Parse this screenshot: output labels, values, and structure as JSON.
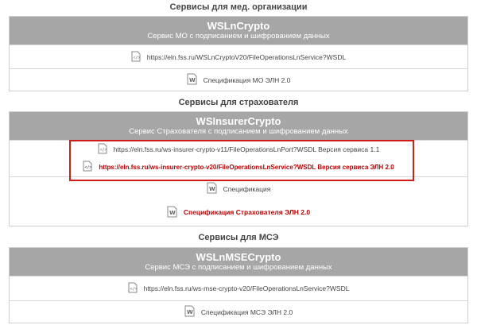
{
  "sections": [
    {
      "title": "Сервисы для мед. организации",
      "service_name": "WSLnCrypto",
      "service_desc": "Сервис МО с подписанием и шифрованием данных",
      "rows": [
        {
          "text": "https://eln.fss.ru/WSLnCryptoV20/FileOperationsLnService?WSDL",
          "icon": "code-file-icon"
        },
        {
          "text": "Спецификация МО ЭЛН 2.0",
          "icon": "word-doc-icon"
        }
      ]
    },
    {
      "title": "Сервисы для страхователя",
      "service_name": "WSInsurerCrypto",
      "service_desc": "Сервис Страхователя с подписанием и шифрованием данных",
      "rows": [
        {
          "text": "https://eln.fss.ru/ws-insurer-crypto-v11/FileOperationsLnPort?WSDL Версия сервиса 1.1",
          "icon": "code-file-icon"
        },
        {
          "text": "https://eln.fss.ru/ws-insurer-crypto-v20/FileOperationsLnService?WSDL Версия сервиса ЭЛН 2.0",
          "icon": "code-file-icon"
        },
        {
          "text": "Спецификация",
          "icon": "word-doc-icon"
        },
        {
          "text": "Спецификация Страхователя ЭЛН 2.0",
          "icon": "word-doc-icon"
        }
      ]
    },
    {
      "title": "Сервисы для МСЭ",
      "service_name": "WSLnMSECrypto",
      "service_desc": "Сервис МСЭ с подписанием и шифрованием данных",
      "rows": [
        {
          "text": "https://eln.fss.ru/ws-mse-crypto-v20/FileOperationsLnService?WSDL",
          "icon": "code-file-icon"
        },
        {
          "text": "Спецификация МСЭ ЭЛН 2.0",
          "icon": "word-doc-icon"
        }
      ]
    }
  ],
  "colors": {
    "header_bg": "#a6a6a6",
    "highlight": "#d11a1a",
    "red_text": "#c00000"
  }
}
